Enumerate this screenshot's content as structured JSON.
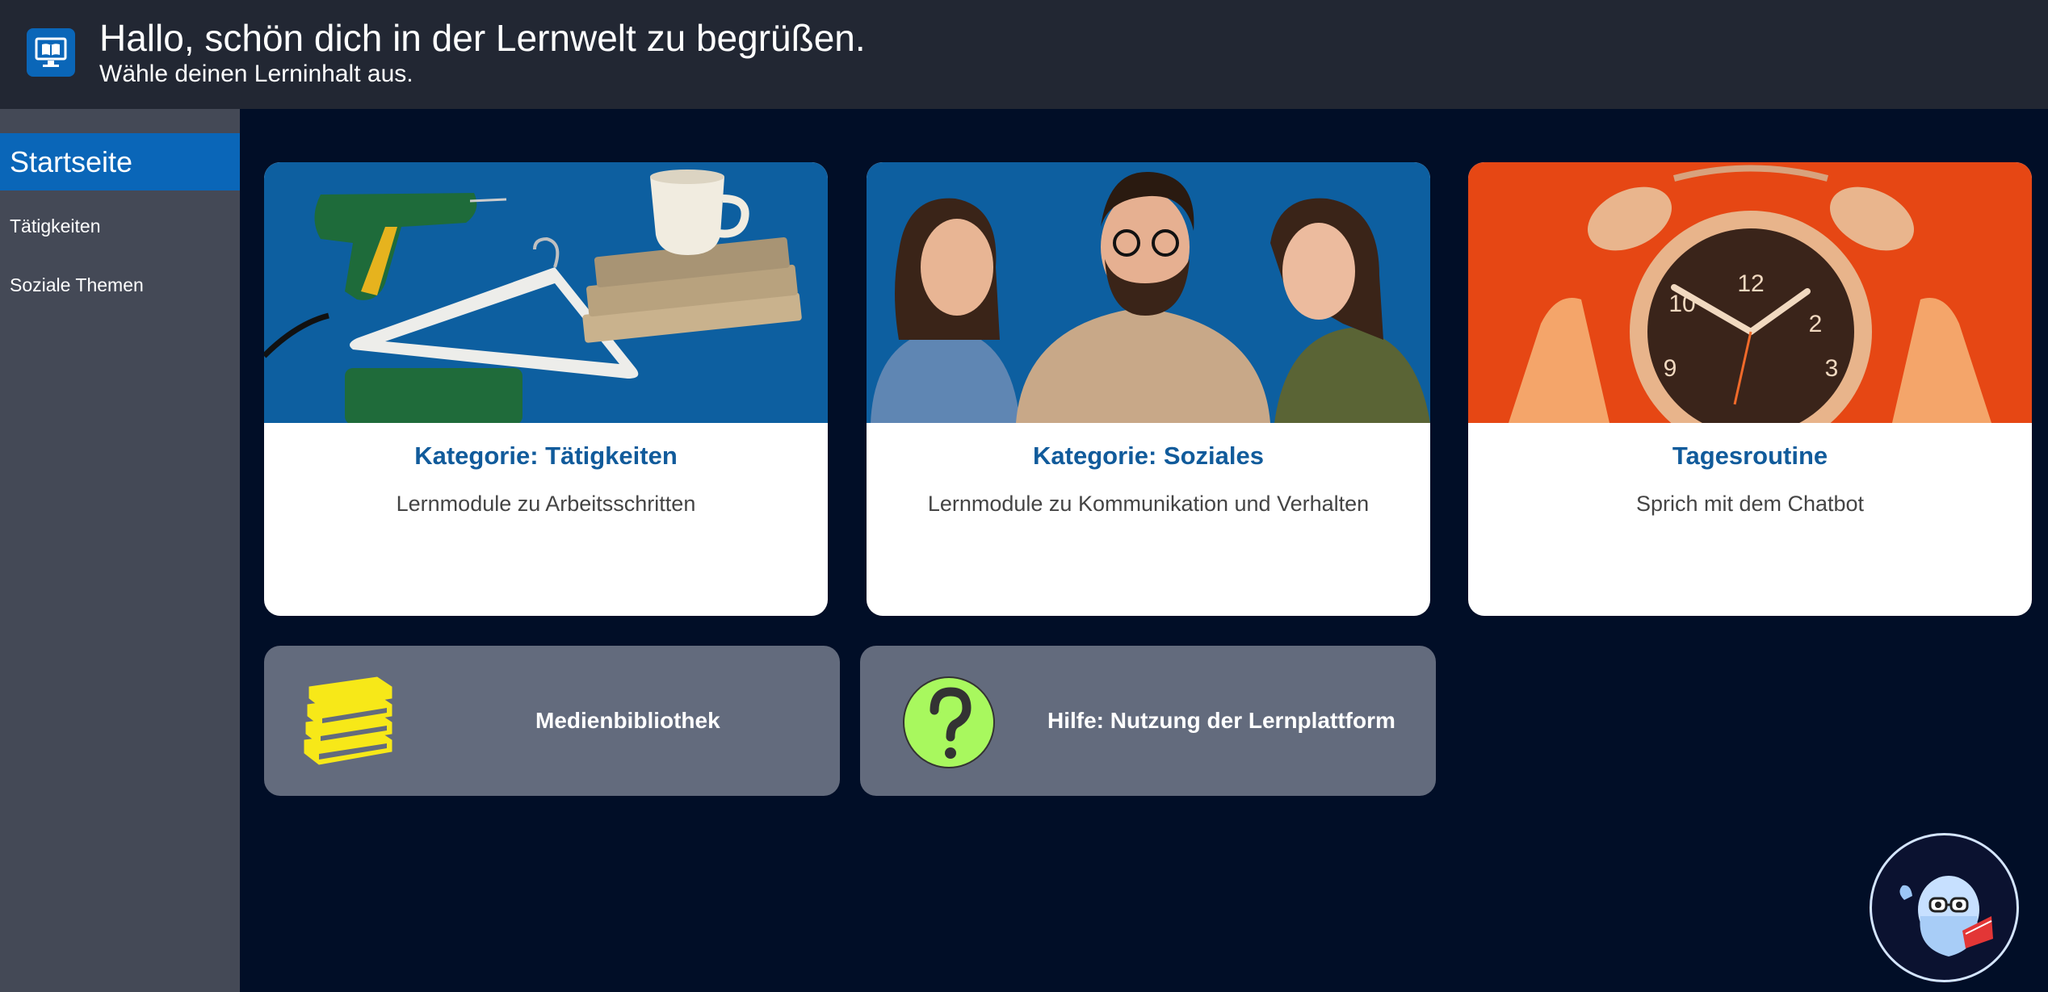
{
  "header": {
    "title": "Hallo, schön dich in der Lernwelt zu begrüßen.",
    "subtitle": "Wähle deinen Lerninhalt aus.",
    "logo_icon": "monitor-book-icon"
  },
  "sidebar": {
    "items": [
      {
        "label": "Startseite",
        "active": true
      },
      {
        "label": "Tätigkeiten",
        "active": false
      },
      {
        "label": "Soziale Themen",
        "active": false
      }
    ]
  },
  "cards": [
    {
      "title": "Kategorie: Tätigkeiten",
      "description": "Lernmodule zu Arbeitsschritten",
      "image": "tagging-gun-hanger-books-cup"
    },
    {
      "title": "Kategorie: Soziales",
      "description": "Lernmodule zu Kommunikation und Verhalten",
      "image": "three-people-laughing"
    },
    {
      "title": "Tagesroutine",
      "description": "Sprich mit dem Chatbot",
      "image": "alarm-clock-in-hands"
    }
  ],
  "tiles": [
    {
      "label": "Medienbibliothek",
      "icon": "books-stack-icon"
    },
    {
      "label": "Hilfe: Nutzung der Lernplattform",
      "icon": "question-mark-icon"
    }
  ],
  "chatbot": {
    "icon": "chatbot-mascot-icon"
  },
  "colors": {
    "header_bg": "#222733",
    "sidebar_bg": "#444956",
    "accent": "#0a66b8",
    "page_bg": "#010e27",
    "tile_bg": "#636b7d",
    "card_title": "#115b9b"
  }
}
